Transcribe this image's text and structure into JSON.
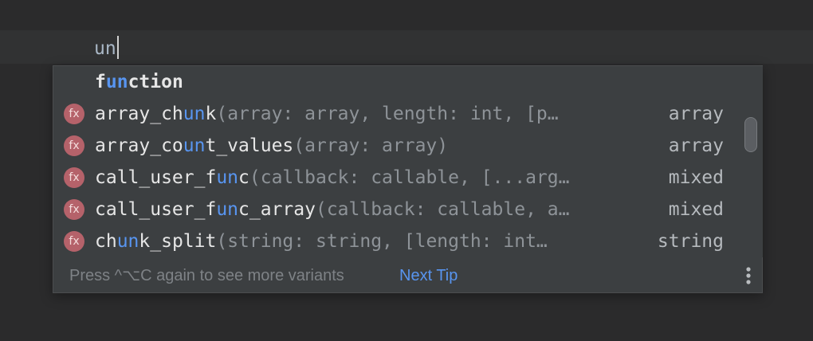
{
  "editor": {
    "typed_text": "un",
    "colors": {
      "background": "#2b2b2c",
      "current_line": "#313233",
      "popup": "#3c3f41",
      "highlight": "#5895f0",
      "params": "#8e9398",
      "fx_icon": "#b5626a"
    }
  },
  "completion": {
    "items": [
      {
        "kind": "keyword",
        "icon": "",
        "name_pre": "f",
        "name_hl": "un",
        "name_post": "ction",
        "params": "",
        "return_type": ""
      },
      {
        "kind": "function",
        "icon": "fx",
        "name_pre": "array_ch",
        "name_hl": "un",
        "name_post": "k",
        "params": "(array: array, length: int, [p…",
        "return_type": "array"
      },
      {
        "kind": "function",
        "icon": "fx",
        "name_pre": "array_co",
        "name_hl": "un",
        "name_post": "t_values",
        "params": "(array: array)",
        "return_type": "array"
      },
      {
        "kind": "function",
        "icon": "fx",
        "name_pre": "call_user_f",
        "name_hl": "un",
        "name_post": "c",
        "params": "(callback: callable, [...arg…",
        "return_type": "mixed"
      },
      {
        "kind": "function",
        "icon": "fx",
        "name_pre": "call_user_f",
        "name_hl": "un",
        "name_post": "c_array",
        "params": "(callback: callable, a…",
        "return_type": "mixed"
      },
      {
        "kind": "function",
        "icon": "fx",
        "name_pre": "ch",
        "name_hl": "un",
        "name_post": "k_split",
        "params": "(string: string, [length: int…",
        "return_type": "string"
      }
    ],
    "footer": {
      "tip_text": "Press ^⌥C again to see more variants",
      "next_tip_label": "Next Tip",
      "more_icon": "vertical-ellipsis-icon"
    }
  }
}
